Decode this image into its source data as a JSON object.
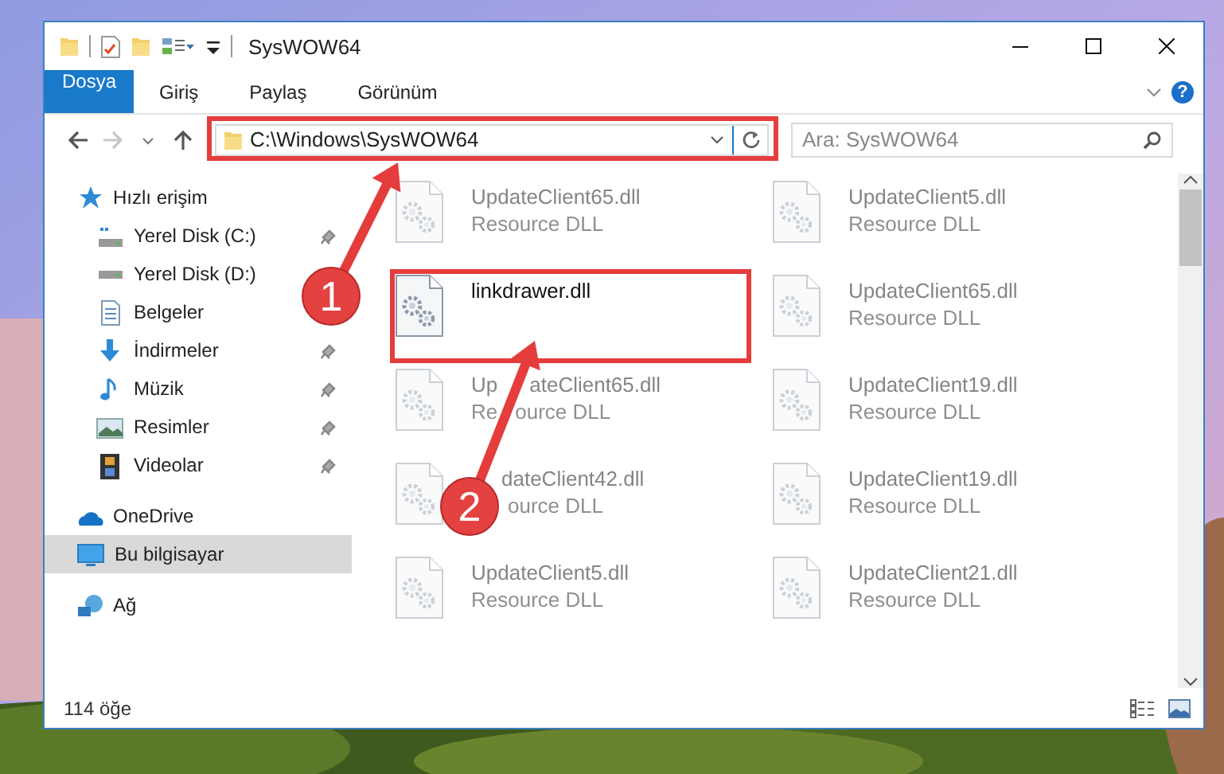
{
  "window": {
    "title": "SysWOW64"
  },
  "ribbon": {
    "tabs": [
      {
        "label": "Dosya",
        "kind": "file"
      },
      {
        "label": "Giriş",
        "kind": "tab"
      },
      {
        "label": "Paylaş",
        "kind": "tab"
      },
      {
        "label": "Görünüm",
        "kind": "tab"
      }
    ],
    "help": "?"
  },
  "navigation": {
    "back_disabled": false,
    "forward_disabled": true
  },
  "address": {
    "value": "C:\\Windows\\SysWOW64"
  },
  "search": {
    "placeholder": "Ara: SysWOW64"
  },
  "sidebar": {
    "items": [
      {
        "label": "Hızlı erişim",
        "selected": false,
        "children": [
          {
            "label": "Yerel Disk (C:)",
            "pinned": true
          },
          {
            "label": "Yerel Disk (D:)",
            "pinned": false
          },
          {
            "label": "Belgeler",
            "pinned": false
          },
          {
            "label": "İndirmeler",
            "pinned": true
          },
          {
            "label": "Müzik",
            "pinned": true
          },
          {
            "label": "Resimler",
            "pinned": true
          },
          {
            "label": "Videolar",
            "pinned": true
          }
        ]
      },
      {
        "label": "OneDrive",
        "selected": false
      },
      {
        "label": "Bu bilgisayar",
        "selected": true
      },
      {
        "label": "Ağ",
        "selected": false
      }
    ]
  },
  "files": [
    {
      "name": [
        "UpdateClient65.dll"
      ],
      "type": [
        "Resource DLL"
      ],
      "blurred": true
    },
    {
      "name": [
        "UpdateClient5.dll"
      ],
      "type": [
        "Resource DLL"
      ],
      "blurred": true
    },
    {
      "name": [
        "linkdrawer.dll"
      ],
      "blurred": false
    },
    {
      "name": [
        "UpdateClient65.dll"
      ],
      "type": [
        "Resource DLL"
      ],
      "blurred": true
    },
    {
      "name": [
        "Up",
        "ateClient65.dll"
      ],
      "type": [
        "Re",
        "ource DLL"
      ],
      "blurred": true
    },
    {
      "name": [
        "UpdateClient19.dll"
      ],
      "type": [
        "Resource DLL"
      ],
      "blurred": true
    },
    {
      "name": [
        "dateClient42.dll"
      ],
      "type": [
        "ource DLL"
      ],
      "lead_hidden": true,
      "blurred": true
    },
    {
      "name": [
        "UpdateClient19.dll"
      ],
      "type": [
        "Resource DLL"
      ],
      "blurred": true
    },
    {
      "name": [
        "UpdateClient5.dll"
      ],
      "type": [
        "Resource DLL"
      ],
      "blurred": true
    },
    {
      "name": [
        "UpdateClient21.dll"
      ],
      "type": [
        "Resource DLL"
      ],
      "blurred": true
    }
  ],
  "status_bar": {
    "item_count": "114 öğe"
  },
  "annotations": [
    {
      "number": "1"
    },
    {
      "number": "2"
    }
  ]
}
